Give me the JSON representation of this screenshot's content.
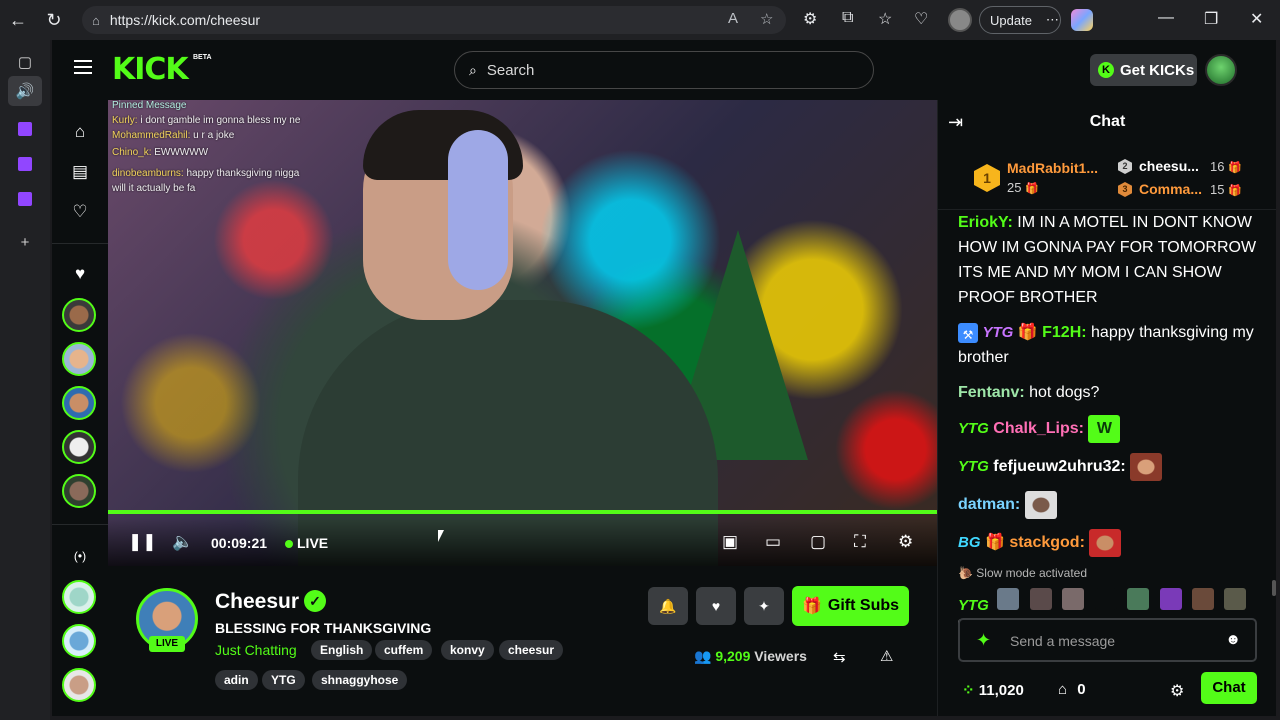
{
  "browser": {
    "url": "https://kick.com/cheesur",
    "update_label": "Update"
  },
  "header": {
    "logo": "KICK",
    "beta": "BETA",
    "search_placeholder": "Search",
    "get_kicks_label": "Get KICKs"
  },
  "player": {
    "pinned_title": "Pinned Message",
    "overlay_lines": [
      {
        "user": "Kurly:",
        "text": "i dont gamble im gonna bless my ne"
      },
      {
        "user": "MohammedRahil:",
        "text": "u r a joke"
      },
      {
        "user": "Chino_k:",
        "text": "EWWWWW"
      },
      {
        "user": "dinobeamburns:",
        "text": "happy thanksgiving nigga"
      },
      {
        "user": "",
        "text": "will it actually be fa"
      }
    ],
    "time": "00:09:21",
    "live_label": "LIVE",
    "progress": 1.0
  },
  "stream": {
    "streamer": "Cheesur",
    "live_badge": "LIVE",
    "title": "BLESSING FOR THANKSGIVING",
    "category": "Just Chatting",
    "tags": [
      "English",
      "cuffem",
      "konvy",
      "cheesur",
      "adin",
      "YTG",
      "shnaggyhose"
    ],
    "gift_subs_label": "Gift Subs",
    "viewers_count": "9,209",
    "viewers_label": "Viewers"
  },
  "chat": {
    "title": "Chat",
    "leaderboard": [
      {
        "rank": "1",
        "name": "MadRabbit1...",
        "count": "25"
      },
      {
        "rank": "2",
        "name": "cheesu...",
        "count": "16"
      },
      {
        "rank": "3",
        "name": "Comma...",
        "count": "15"
      }
    ],
    "messages": [
      {
        "user": "EriokY:",
        "text": "IM IN A MOTEL IN DONT KNOW HOW IM GONNA PAY FOR TOMORROW ITS ME AND MY MOM I CAN SHOW PROOF BROTHER",
        "color": "#53fc18"
      },
      {
        "user": "F12H:",
        "text": "happy thanksgiving my brother",
        "color": "#53fc18"
      },
      {
        "user": "Fentanv:",
        "text": "hot dogs?",
        "color": "#9ee6a8"
      },
      {
        "user": "Chalk_Lips:",
        "text": "",
        "color": "#ff6fb5"
      },
      {
        "user": "fefjueuw2uhru32:",
        "text": "",
        "color": "#ffffff"
      },
      {
        "user": "datman:",
        "text": "",
        "color": "#7ad3ff"
      },
      {
        "user": "stackgod:",
        "text": "",
        "color": "#ff9a3c"
      }
    ],
    "badges": {
      "ytg": "YTG",
      "bg": "BG"
    },
    "slow_mode": "Slow mode activated",
    "send_placeholder": "Send a message",
    "points": "11,020",
    "store_count": "0",
    "chat_button": "Chat"
  },
  "colors": {
    "accent": "#53fc18",
    "background": "#0b0e0f"
  }
}
